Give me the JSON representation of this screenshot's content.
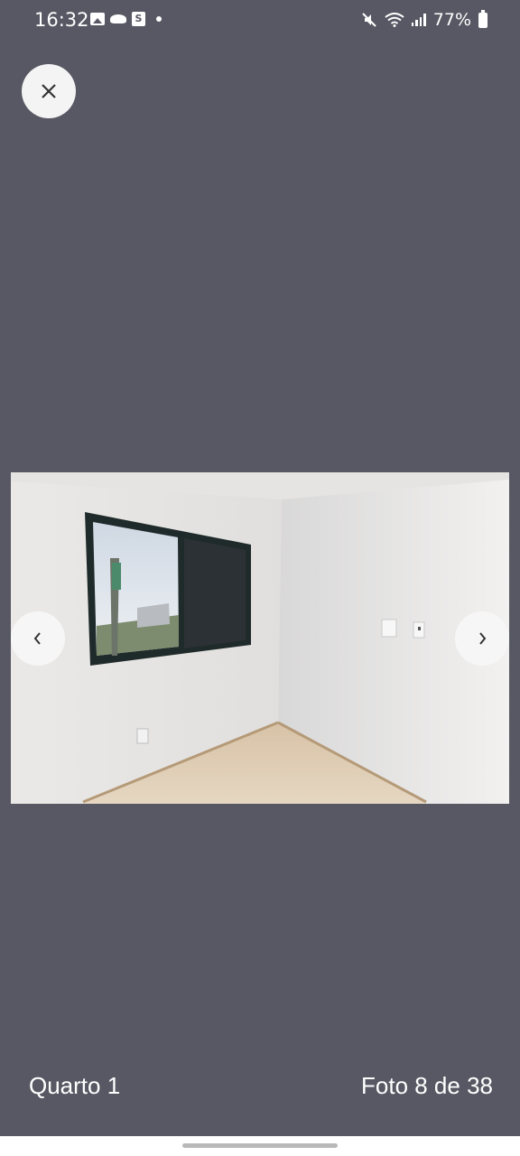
{
  "status_bar": {
    "time": "16:32",
    "battery": "77%",
    "icons_left": [
      "gallery-icon",
      "bird-icon",
      "shop-icon",
      "dot-icon"
    ],
    "icons_right": [
      "mute-icon",
      "wifi-icon",
      "signal-icon",
      "battery-icon"
    ]
  },
  "viewer": {
    "close_icon": "close-icon",
    "prev_icon": "chevron-left-icon",
    "next_icon": "chevron-right-icon",
    "photo_label": "Quarto 1",
    "photo_counter": "Foto 8 de 38",
    "current_photo": 8,
    "total_photos": 38
  },
  "colors": {
    "background": "#585864",
    "button_bg": "#f4f4f4",
    "text": "#ffffff"
  }
}
